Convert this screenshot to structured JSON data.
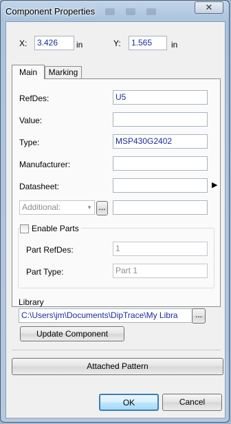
{
  "window": {
    "title": "Component Properties",
    "close_glyph": "✕"
  },
  "position": {
    "x_label": "X:",
    "x_value": "3.426",
    "x_unit": "in",
    "y_label": "Y:",
    "y_value": "1.565",
    "y_unit": "in"
  },
  "tabs": [
    {
      "label": "Main",
      "active": true
    },
    {
      "label": "Marking",
      "active": false
    }
  ],
  "main": {
    "refdes_label": "RefDes:",
    "refdes_value": "U5",
    "value_label": "Value:",
    "value_value": "",
    "type_label": "Type:",
    "type_value": "MSP430G2402",
    "manufacturer_label": "Manufacturer:",
    "manufacturer_value": "",
    "datasheet_label": "Datasheet:",
    "datasheet_value": "",
    "datasheet_arrow": "▶",
    "additional_placeholder": "Additional:",
    "additional_value": "",
    "browse_label": "...",
    "enable_parts_label": "Enable Parts",
    "enable_parts_checked": false,
    "part_refdes_label": "Part RefDes:",
    "part_refdes_value": "1",
    "part_type_label": "Part Type:",
    "part_type_value": "Part 1"
  },
  "library": {
    "label": "Library",
    "path": "C:\\Users\\jm\\Documents\\DipTrace\\My Libra",
    "browse_label": "...",
    "update_button": "Update Component"
  },
  "attached_pattern_button": "Attached Pattern",
  "ok_button": "OK",
  "cancel_button": "Cancel",
  "colors": {
    "value_text": "#1a2c9a",
    "disabled_text": "#8d8d8d",
    "ok_border": "#3c7fb1"
  }
}
